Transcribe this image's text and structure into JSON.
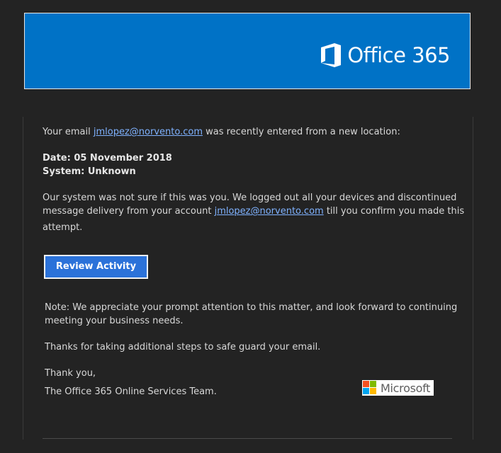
{
  "header": {
    "brand": "Office 365",
    "banner_color": "#0072c6",
    "logo_icon": "office-logo-icon"
  },
  "body": {
    "intro_prefix": "Your email ",
    "email": "jmlopez@norvento.com",
    "intro_suffix": " was recently entered from a new location:",
    "date_line": "Date: 05 November 2018",
    "system_line": "System: Unknown",
    "para1_line1": "Our system was not sure if this was you. We logged out all your devices and discontinued",
    "para1_line2_prefix": "message delivery from your account ",
    "para1_line2_suffix": " till you confirm you made this",
    "para1_line3": "attempt.",
    "button_label": "Review Activity",
    "note_line1": "Note: We appreciate your prompt attention to this matter, and look forward to continuing",
    "note_line2": "meeting your business needs.",
    "thanks": "Thanks for taking additional steps to safe guard your email.",
    "closing": "Thank you,",
    "signature": "The Office 365 Online Services Team."
  },
  "footer_logo": {
    "word": "Microsoft",
    "icon": "microsoft-logo-icon",
    "colors": [
      "#f25022",
      "#7fba00",
      "#00a4ef",
      "#ffb900"
    ]
  }
}
